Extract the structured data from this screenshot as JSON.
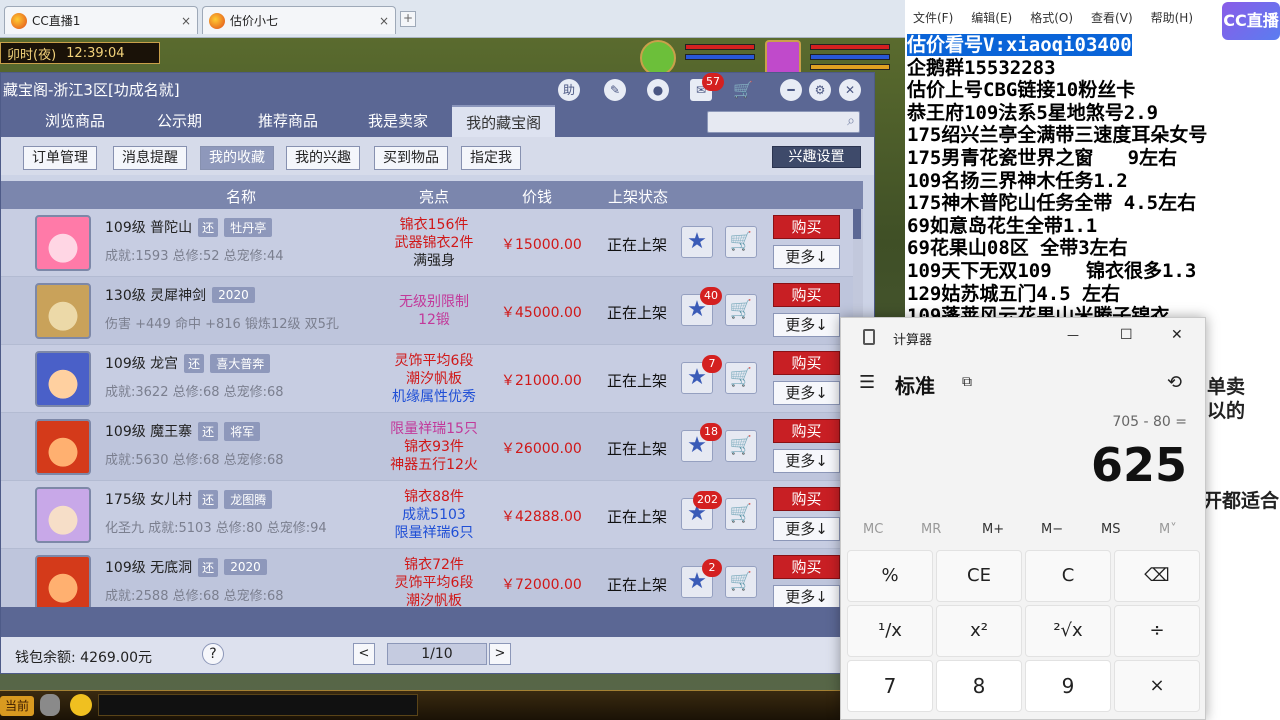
{
  "browser": {
    "tabs": [
      {
        "label": "CC直播1"
      },
      {
        "label": "估价小七"
      }
    ],
    "add": "+",
    "close": "×"
  },
  "game": {
    "clock_time": "卯时(夜)",
    "clock_clock": "12:39:04",
    "current": "当前"
  },
  "cbg": {
    "title": "藏宝阁-浙江3区[功成名就]",
    "title_help": "助",
    "msg_count": "57",
    "nav": [
      "浏览商品",
      "公示期",
      "推荐商品",
      "我是卖家",
      "我的藏宝阁"
    ],
    "subnav": [
      "订单管理",
      "消息提醒",
      "我的收藏",
      "我的兴趣",
      "买到物品",
      "指定我"
    ],
    "interest_button": "兴趣设置",
    "headers": {
      "name": "名称",
      "highlight": "亮点",
      "price": "价钱",
      "status": "上架状态"
    },
    "rows": [
      {
        "level_school": "109级  普陀山",
        "tag1": "还",
        "tag2": "牡丹亭",
        "info": "成就:1593  总修:52  总宠修:44",
        "highlights": [
          {
            "t": "锦衣156件",
            "c": "r"
          },
          {
            "t": "武器锦衣2件",
            "c": "r"
          },
          {
            "t": "满强身",
            "c": "k"
          }
        ],
        "price": "￥15000.00",
        "status": "正在上架",
        "badge": "",
        "buy": "购买",
        "more": "更多↓"
      },
      {
        "level_school": "130级  灵犀神剑",
        "tag1": "",
        "tag2": "2020",
        "info": "伤害 +449  命中 +816  锻炼12级  双5孔",
        "highlights": [
          {
            "t": "无级别限制",
            "c": "p"
          },
          {
            "t": "12锻",
            "c": "p"
          }
        ],
        "price": "￥45000.00",
        "status": "正在上架",
        "badge": "40",
        "buy": "购买",
        "more": "更多↓"
      },
      {
        "level_school": "109级  龙宫",
        "tag1": "还",
        "tag2": "喜大普奔",
        "info": "成就:3622  总修:68  总宠修:68",
        "highlights": [
          {
            "t": "灵饰平均6段",
            "c": "r"
          },
          {
            "t": "潮汐帆板",
            "c": "r"
          },
          {
            "t": "机缘属性优秀",
            "c": "b"
          }
        ],
        "price": "￥21000.00",
        "status": "正在上架",
        "badge": "7",
        "buy": "购买",
        "more": "更多↓"
      },
      {
        "level_school": "109级  魔王寨",
        "tag1": "还",
        "tag2": "将军",
        "info": "成就:5630  总修:68  总宠修:68",
        "highlights": [
          {
            "t": "限量祥瑞15只",
            "c": "p"
          },
          {
            "t": "锦衣93件",
            "c": "r"
          },
          {
            "t": "神器五行12火",
            "c": "r"
          }
        ],
        "price": "￥26000.00",
        "status": "正在上架",
        "badge": "18",
        "buy": "购买",
        "more": "更多↓"
      },
      {
        "level_school": "175级  女儿村",
        "tag1": "还",
        "tag2": "龙图腾",
        "info": "化圣九  成就:5103  总修:80  总宠修:94",
        "highlights": [
          {
            "t": "锦衣88件",
            "c": "r"
          },
          {
            "t": "成就5103",
            "c": "b"
          },
          {
            "t": "限量祥瑞6只",
            "c": "b"
          }
        ],
        "price": "￥42888.00",
        "status": "正在上架",
        "badge": "202",
        "buy": "购买",
        "more": "更多↓"
      },
      {
        "level_school": "109级  无底洞",
        "tag1": "还",
        "tag2": "2020",
        "info": "成就:2588  总修:68  总宠修:68",
        "highlights": [
          {
            "t": "锦衣72件",
            "c": "r"
          },
          {
            "t": "灵饰平均6段",
            "c": "r"
          },
          {
            "t": "潮汐帆板",
            "c": "r"
          }
        ],
        "price": "￥72000.00",
        "status": "正在上架",
        "badge": "2",
        "buy": "购买",
        "more": "更多↓"
      }
    ],
    "wallet": "钱包余额: 4269.00元",
    "help": "?",
    "page": "1/10",
    "prev": "<",
    "next": ">"
  },
  "notepad": {
    "menu": [
      "文件(F)",
      "编辑(E)",
      "格式(O)",
      "查看(V)",
      "帮助(H)"
    ],
    "lines": [
      "估价看号V:xiaoqi03400",
      "企鹅群15532283",
      "估价上号CBG链接10粉丝卡",
      "恭王府109法系5星地煞号2.9",
      "175绍兴兰亭全满带三速度耳朵女号",
      "175男青花瓷世界之窗   9左右",
      "109名扬三界神木任务1.2",
      "175神木普陀山任务全带 4.5左右",
      "69如意岛花生全带1.1",
      "69花果山08区 全带3左右",
      "109天下无双109   锦衣很多1.3",
      "129姑苏城五门4.5 左右",
      "109蓬莱风云花果山米腾子锦衣"
    ],
    "fragments": [
      "单卖",
      "以的",
      "开都适合"
    ]
  },
  "cc_logo": "CC直播",
  "calculator": {
    "title": "计算器",
    "mode": "标准",
    "expression": "705 - 80 =",
    "result": "625",
    "memory": [
      "MC",
      "MR",
      "M+",
      "M−",
      "MS",
      "M˅"
    ],
    "keys": [
      "%",
      "CE",
      "C",
      "⌫",
      "¹/x",
      "x²",
      "²√x",
      "÷",
      "7",
      "8",
      "9",
      "×"
    ],
    "window_min": "—",
    "window_max": "☐",
    "window_close": "✕"
  }
}
